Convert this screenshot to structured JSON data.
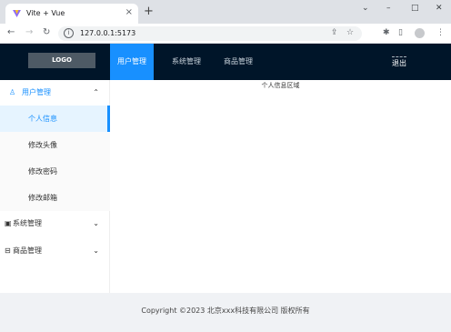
{
  "browser": {
    "tab_title": "Vite + Vue",
    "tab_close": "×",
    "new_tab": "+",
    "url": "127.0.0.1:5173",
    "info_icon": "i",
    "window_controls": {
      "minimize": "⌄",
      "min2": "–",
      "restore": "□",
      "close": "✕"
    },
    "nav": {
      "back": "←",
      "forward": "→",
      "reload": "↻"
    },
    "icons": {
      "share": "⇪",
      "star": "☆",
      "puzzle": "✱",
      "sidepanel": "▯",
      "menu": "⋮"
    }
  },
  "header": {
    "logo": "LOGO",
    "nav": [
      "用户管理",
      "系统管理",
      "商品管理"
    ],
    "active_nav_index": 0,
    "logout": "退出",
    "accent": "#1890ff",
    "background": "#001529"
  },
  "sidebar": {
    "menus": [
      {
        "icon": "user-icon",
        "glyph": "♙",
        "label": "用户管理",
        "open": true,
        "chevron": "⌃",
        "items": [
          {
            "label": "个人信息",
            "active": true
          },
          {
            "label": "修改头像",
            "active": false
          },
          {
            "label": "修改密码",
            "active": false
          },
          {
            "label": "修改邮箱",
            "active": false
          }
        ]
      },
      {
        "icon": "monitor-icon",
        "glyph": "▣",
        "label": "系统管理",
        "open": false,
        "chevron": "⌄"
      },
      {
        "icon": "shop-icon",
        "glyph": "⊟",
        "label": "商品管理",
        "open": false,
        "chevron": "⌄"
      }
    ]
  },
  "content": {
    "label": "个人信息区域"
  },
  "footer": {
    "text": "Copyright ©2023 北京xxx科技有限公司 版权所有"
  }
}
